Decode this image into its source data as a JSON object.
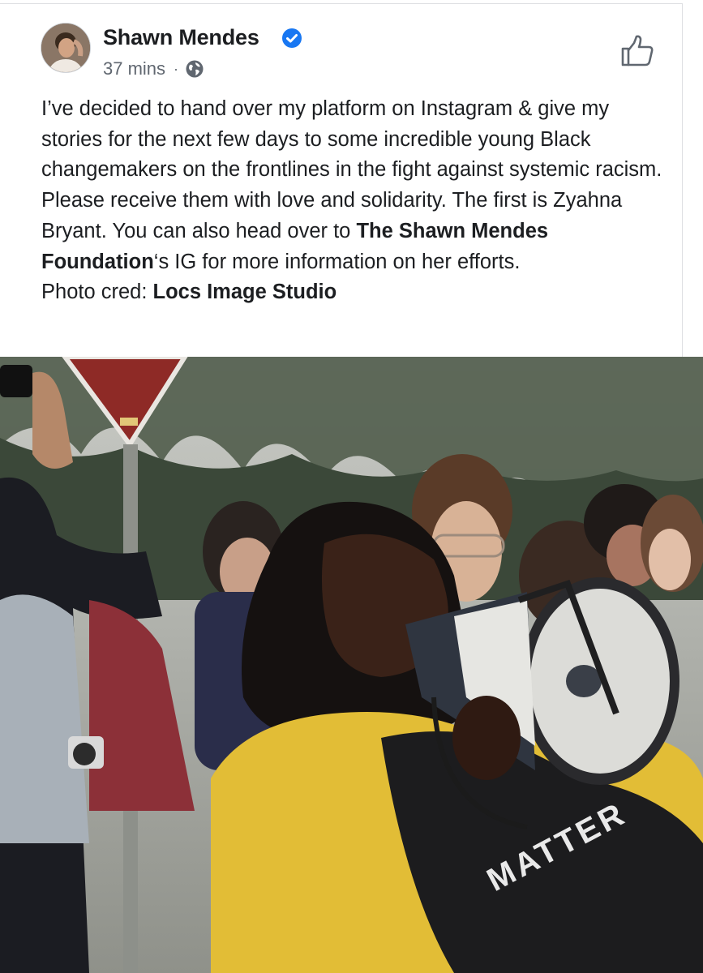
{
  "post": {
    "author": "Shawn Mendes",
    "time": "37 mins",
    "separator": "·",
    "body": {
      "text_1": "I’ve decided to hand over my platform on Instagram & give my stories for the next few days to some incredible young Black changemakers on the frontlines in the fight against systemic racism. Please receive them with love and solidarity. The first is Zyahna Bryant. You can also head over to ",
      "foundation": "The Shawn Mendes Foundation",
      "text_2": "‘s IG for more information on her efforts.",
      "credit_label": "Photo cred: ",
      "credit_name": "Locs Image Studio"
    },
    "photo": {
      "shirt_text": "MATTER"
    }
  },
  "icons": {
    "verified": "verified-badge-icon",
    "privacy": "globe-icon",
    "like": "thumbs-up-icon"
  },
  "colors": {
    "verified_blue": "#1877f2",
    "meta_grey": "#606770",
    "text": "#1c1e21",
    "sweater_yellow": "#e8c33a"
  }
}
